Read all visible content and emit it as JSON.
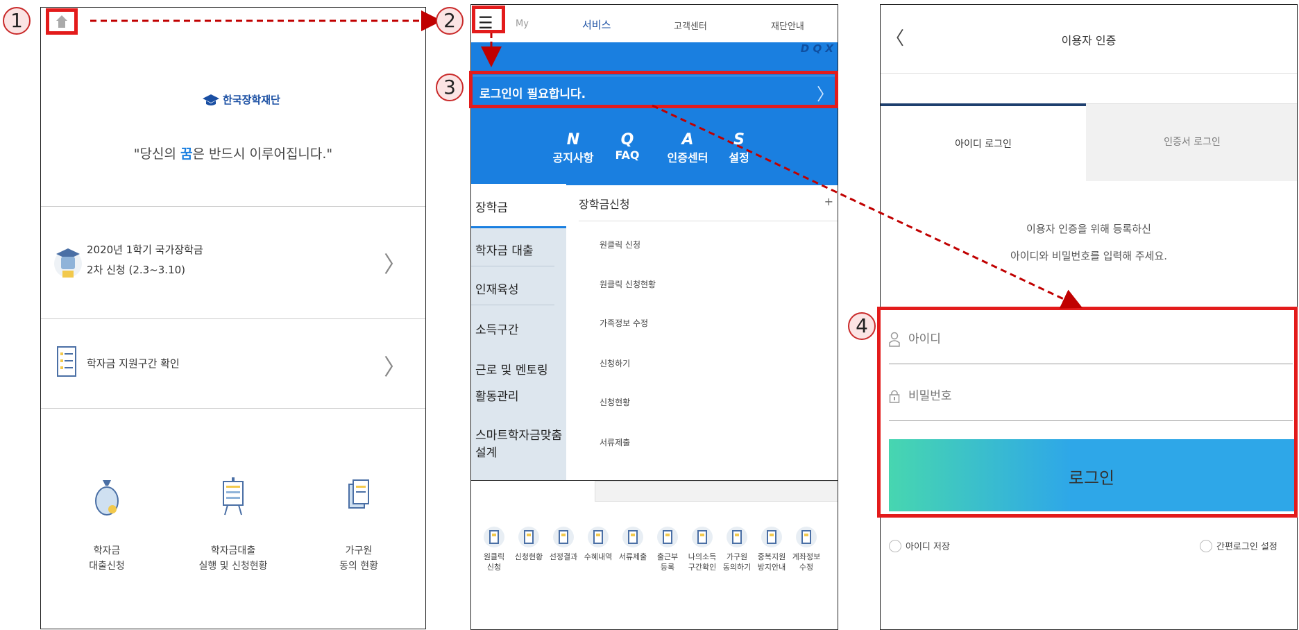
{
  "steps": [
    "1",
    "2",
    "3",
    "4"
  ],
  "panel1": {
    "logo_text": "한국장학재단",
    "slogan_pre": "\"당신의 ",
    "slogan_highlight": "꿈",
    "slogan_post": "은 반드시 이루어집니다.\"",
    "menu": [
      {
        "line1": "2020년 1학기 국가장학금",
        "line2": "2차 신청 (2.3~3.10)",
        "icon": "graduation-cap-icon"
      },
      {
        "line1": "학자금 지원구간 확인",
        "line2": "",
        "icon": "document-checklist-icon"
      }
    ],
    "quick": [
      {
        "line1": "학자금",
        "line2": "대출신청",
        "icon": "money-bag-icon"
      },
      {
        "line1": "학자금대출",
        "line2": "실행 및 신청현황",
        "icon": "presentation-board-icon"
      },
      {
        "line1": "가구원",
        "line2": "동의 현황",
        "icon": "document-copy-icon"
      }
    ],
    "chevron": "〉"
  },
  "panel2": {
    "hamburger": "☰",
    "nav": [
      "My",
      "서비스",
      "고객센터",
      "재단안내"
    ],
    "ghost_letters": "D  Q  X",
    "login_required": "로그인이 필요합니다.",
    "chevron": "〉",
    "shortcuts": [
      {
        "letter": "N",
        "label": "공지사항"
      },
      {
        "letter": "Q",
        "label": "FAQ"
      },
      {
        "letter": "A",
        "label": "인증센터"
      },
      {
        "letter": "S",
        "label": "설정"
      }
    ],
    "left_menu": [
      "장학금",
      "학자금 대출",
      "인재육성",
      "소득구간",
      "근로 및 멘토링",
      "활동관리",
      "스마트학자금맞춤설계"
    ],
    "right_header": "장학금신청",
    "plus": "+",
    "right_items": [
      "원클릭 신청",
      "원클릭 신청현황",
      "가족정보 수정",
      "신청하기",
      "신청현황",
      "서류제출"
    ],
    "icons": [
      {
        "l1": "원클릭",
        "l2": "신청",
        "icon": "click-icon"
      },
      {
        "l1": "신청현황",
        "l2": "",
        "icon": "board-icon"
      },
      {
        "l1": "선정결과",
        "l2": "",
        "icon": "search-doc-icon"
      },
      {
        "l1": "수혜내역",
        "l2": "",
        "icon": "doc-pen-icon"
      },
      {
        "l1": "서류제출",
        "l2": "",
        "icon": "doc-edit-icon"
      },
      {
        "l1": "출근부",
        "l2": "등록",
        "icon": "calendar-icon"
      },
      {
        "l1": "나의소득",
        "l2": "구간확인",
        "icon": "magnifier-icon"
      },
      {
        "l1": "가구원",
        "l2": "동의하기",
        "icon": "doc-check-icon"
      },
      {
        "l1": "중복지원",
        "l2": "방지안내",
        "icon": "copy-icon"
      },
      {
        "l1": "계좌정보",
        "l2": "수정",
        "icon": "account-icon"
      }
    ]
  },
  "panel3": {
    "back": "〈",
    "title": "이용자 인증",
    "tab_id": "아이디 로그인",
    "tab_cert": "인증서 로그인",
    "desc1": "이용자 인증을 위해 등록하신",
    "desc2": "아이디와 비밀번호를 입력해 주세요.",
    "id_placeholder": "아이디",
    "pw_placeholder": "비밀번호",
    "login": "로그인",
    "save_id": "아이디 저장",
    "easy_login": "간편로그인 설정"
  },
  "colors": {
    "accent_red": "#e31b1b",
    "blue": "#1a7fe0",
    "teal_grad_start": "#47d6b0",
    "teal_grad_end": "#2ea7e8"
  }
}
